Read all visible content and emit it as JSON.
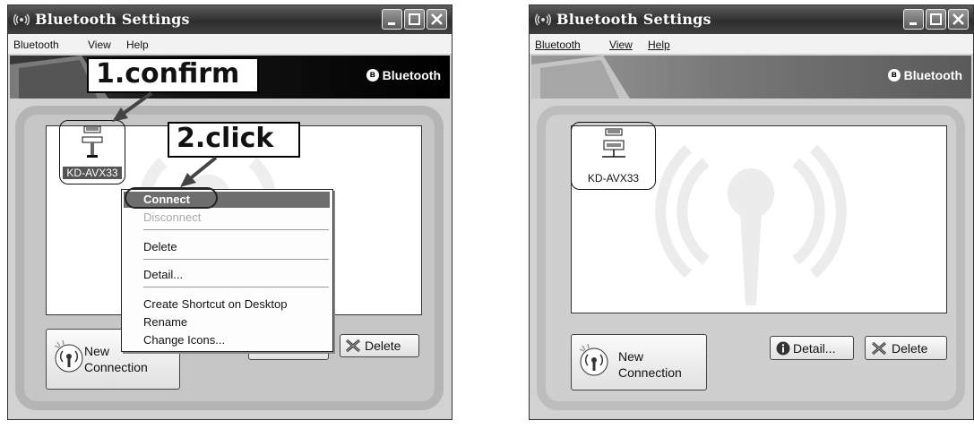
{
  "left_window": {
    "title": "Bluetooth Settings",
    "menu": [
      "Bluetooth",
      "View",
      "Help"
    ],
    "banner_brand": "Bluetooth",
    "device_label": "KD-AVX33",
    "context_menu": {
      "connect": "Connect",
      "disconnect": "Disconnect",
      "delete": "Delete",
      "detail": "Detail...",
      "create_shortcut": "Create Shortcut on Desktop",
      "rename": "Rename",
      "change_icons": "Change Icons..."
    },
    "new_connection_line1": "New",
    "new_connection_line2": "Connection",
    "delete_button": "Delete"
  },
  "right_window": {
    "title": "Bluetooth Settings",
    "menu": [
      "Bluetooth",
      "View",
      "Help"
    ],
    "banner_brand": "Bluetooth",
    "device_label": "KD-AVX33",
    "new_connection_line1": "New",
    "new_connection_line2": "Connection",
    "detail_button": "Detail...",
    "delete_button": "Delete"
  },
  "annotations": {
    "step1": "1.confirm",
    "step2": "2.click"
  },
  "icons": [
    "bluetooth-antenna-icon",
    "minimize-icon",
    "maximize-icon",
    "close-icon",
    "bluetooth-logo-icon",
    "device-icon",
    "new-connection-icon",
    "info-icon",
    "delete-x-icon"
  ]
}
